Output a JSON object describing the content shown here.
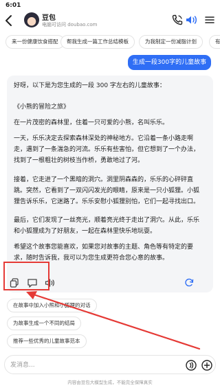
{
  "status_bar": {
    "time": "6:01"
  },
  "header": {
    "bot_name": "豆包",
    "bot_subtitle": "电脑可访问 doubao.com"
  },
  "suggestion_chips": [
    "来一份健康饮食搭配",
    "帮我生成一篇工作总结模板",
    "为我制定一份减脂计划",
    "有哪些"
  ],
  "user_message": "生成一段300字的儿童故事",
  "ai_response": {
    "intro": "好呀，以下是为您生成的一段 300 字左右的儿童故事：",
    "story_title": "《小熊的冒险之旅》",
    "paragraphs": [
      "在一片茂密的森林里，住着一只可爱的小熊，名叫乐乐。",
      "一天，乐乐决定去探索森林深处的神秘地方。它沿着一条小路走啊走，遇到了一条湍急的河流。乐乐有些害怕，但它想到了一个办法，找到了一根粗壮的树枝当作桥，勇敢地过了河。",
      "接着，它走进了一个黑暗的洞穴。洞里阴森森的，乐乐的心砰砰直跳。突然，它看到了一双闪闪发光的眼睛，原来是一只小狐狸。小狐狸告诉乐乐，它迷路了。乐乐安慰小狐狸别怕，它们一起寻找出口。",
      "最后，它们发现了一丝亮光，顺着亮光终于走出了洞穴。从此，乐乐和小狐狸成为了好朋友，一起在森林里快乐地玩耍。",
      "希望这个故事您能喜欢，如果您对故事的主题、角色等有特定的要求，随时告诉我，我可以为您生成更符合您心意的故事。"
    ]
  },
  "follow_up_suggestions": [
    "在故事中加入小熊和小狐狸的对话",
    "为故事生成一个不同的结局",
    "推荐一些优秀的儿童故事范本"
  ],
  "input": {
    "placeholder": "发消息..."
  },
  "footer_note": "内容由豆包大模型生成，不能完全保障真实",
  "colors": {
    "accent": "#2f6ef5",
    "highlight": "#e53935"
  }
}
